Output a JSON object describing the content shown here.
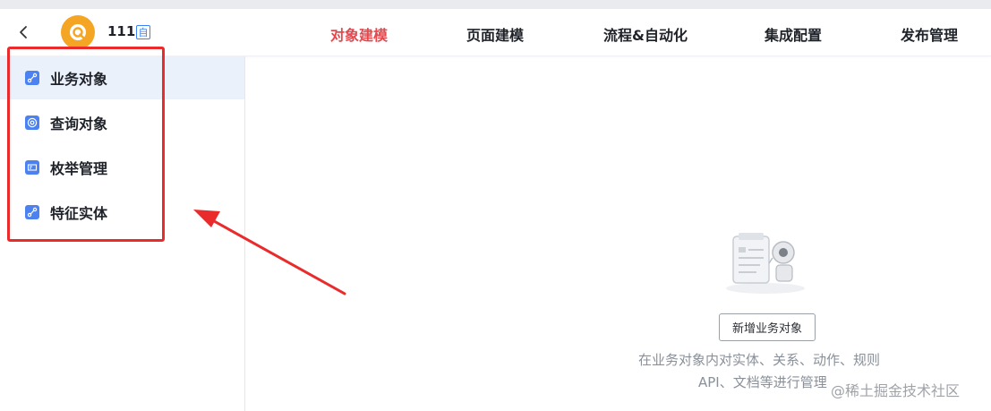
{
  "app": {
    "name": "111",
    "badge": "自"
  },
  "nav": {
    "tabs": [
      {
        "label": "对象建模",
        "active": true
      },
      {
        "label": "页面建模",
        "active": false
      },
      {
        "label": "流程&自动化",
        "active": false
      },
      {
        "label": "集成配置",
        "active": false
      },
      {
        "label": "发布管理",
        "active": false
      }
    ]
  },
  "sidebar": {
    "items": [
      {
        "label": "业务对象",
        "icon": "flow-icon",
        "active": true
      },
      {
        "label": "查询对象",
        "icon": "at-icon",
        "active": false
      },
      {
        "label": "枚举管理",
        "icon": "card-icon",
        "active": false
      },
      {
        "label": "特征实体",
        "icon": "flow-icon",
        "active": false
      }
    ]
  },
  "main": {
    "empty_state": {
      "button_label": "新增业务对象",
      "description_line1": "在业务对象内对实体、关系、动作、规则",
      "description_line2": "API、文档等进行管理"
    }
  },
  "watermark": "@稀土掘金技术社区",
  "colors": {
    "accent": "#e5484d",
    "sidebar_active_bg": "#ebf1fb",
    "icon_blue": "#4c82f0",
    "annotation_red": "#ea2b2b",
    "logo_orange": "#f5a524"
  }
}
